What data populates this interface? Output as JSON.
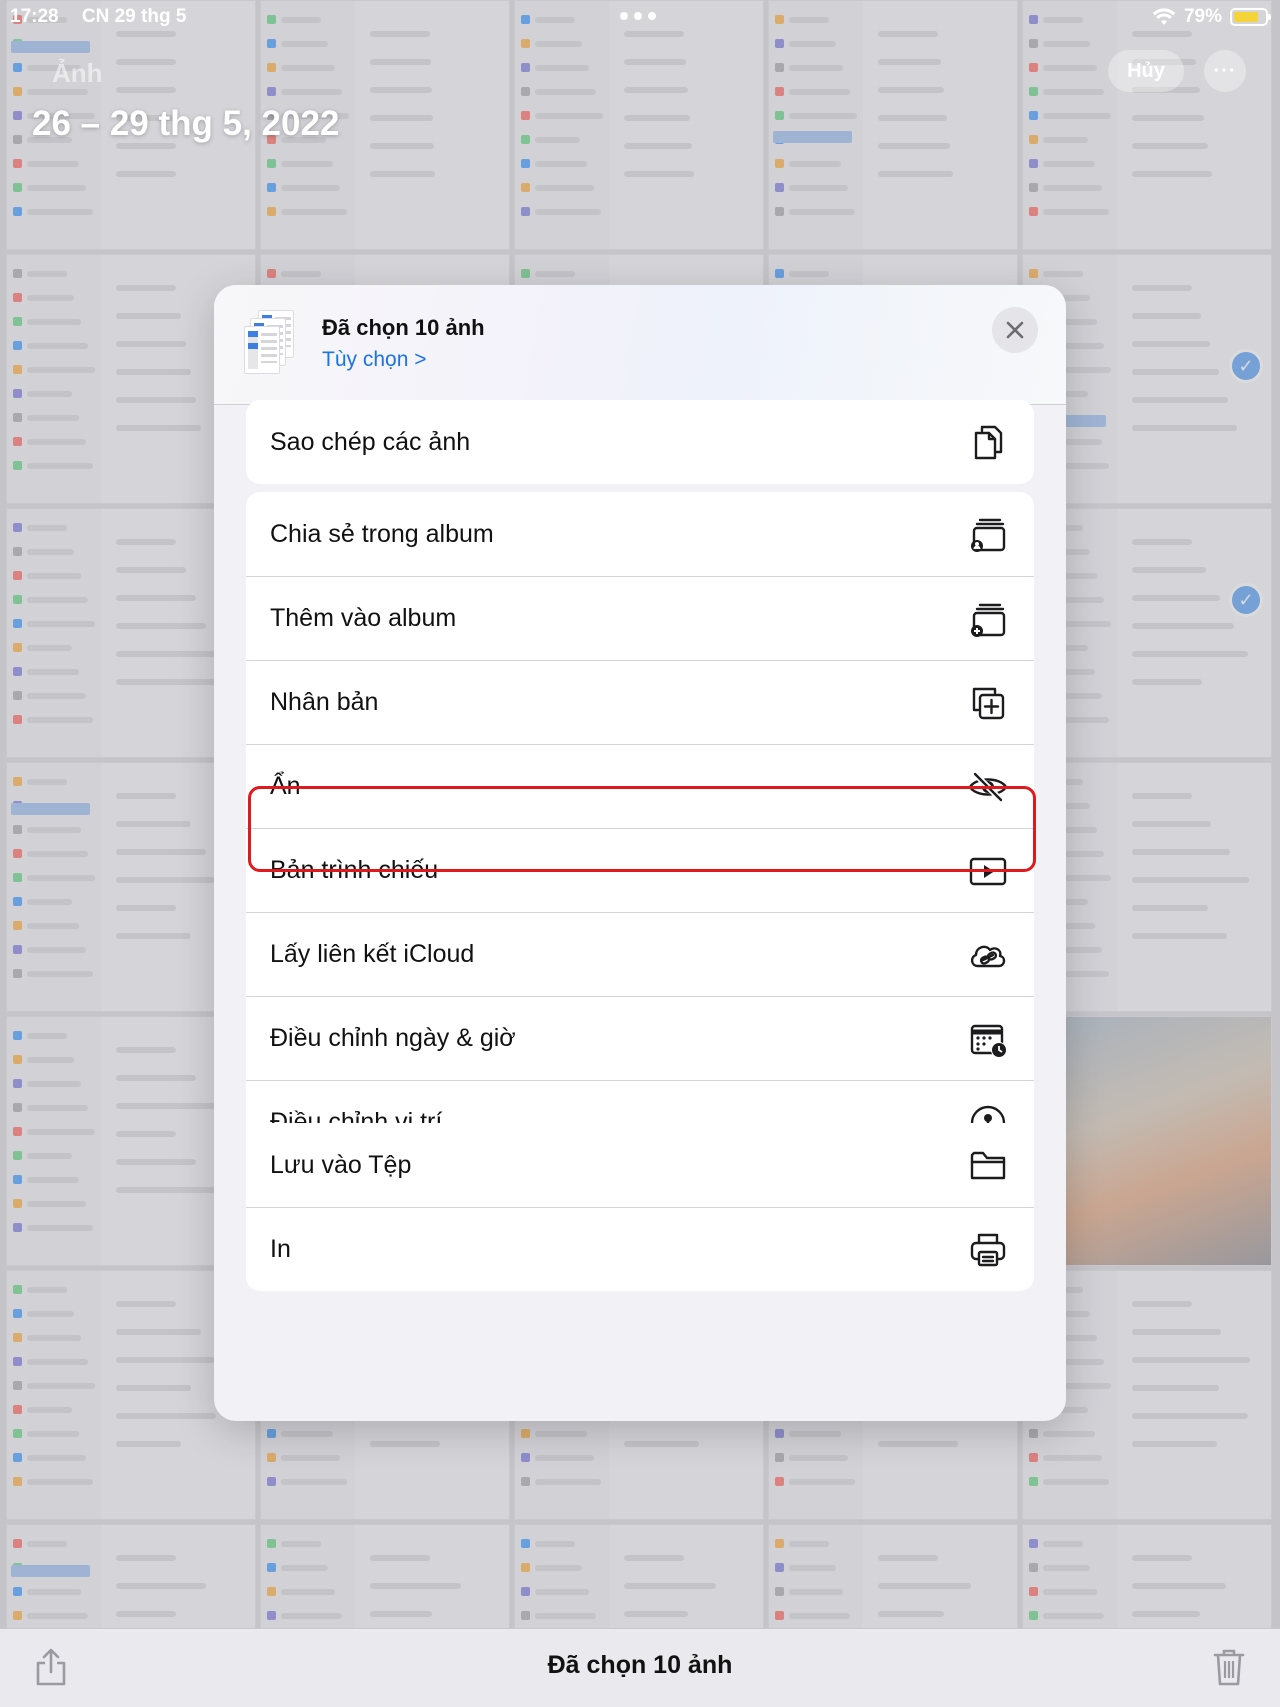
{
  "status_bar": {
    "time": "17:28",
    "date": "CN 29 thg 5",
    "battery": "79%",
    "battery_level": 0.79
  },
  "header": {
    "faded_label": "Ảnh",
    "date_range": "26 – 29 thg 5, 2022",
    "cancel_label": "Hủy",
    "more_label": "···"
  },
  "sheet": {
    "title": "Đã chọn 10 ảnh",
    "options_link": "Tùy chọn >",
    "groups": [
      [
        {
          "label": "Sao chép các ảnh",
          "icon": "copy-icon"
        }
      ],
      [
        {
          "label": "Chia sẻ trong album",
          "icon": "shared-album-icon"
        },
        {
          "label": "Thêm vào album",
          "icon": "add-to-album-icon"
        },
        {
          "label": "Nhân bản",
          "icon": "duplicate-icon"
        },
        {
          "label": "Ẩn",
          "icon": "eye-slash-icon",
          "highlighted": true
        },
        {
          "label": "Bản trình chiếu",
          "icon": "play-icon"
        },
        {
          "label": "Lấy liên kết iCloud",
          "icon": "cloud-link-icon"
        },
        {
          "label": "Điều chỉnh ngày & giờ",
          "icon": "calendar-clock-icon"
        },
        {
          "label": "Điều chỉnh vị trí",
          "icon": "location-pin-icon"
        }
      ],
      [
        {
          "label": "Lưu vào Tệp",
          "icon": "folder-icon"
        },
        {
          "label": "In",
          "icon": "printer-icon"
        }
      ]
    ]
  },
  "toolbar": {
    "title": "Đã chọn 10 ảnh"
  },
  "colors": {
    "accent": "#1a73e8",
    "highlight_border": "#e0191e",
    "selection_check": "#1f7ef0"
  }
}
